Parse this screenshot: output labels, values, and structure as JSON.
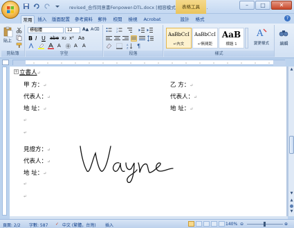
{
  "title_bar": {
    "title": "revised_合作同意書Fenpower-DTL.docx [相容模式] - Microsoft ...",
    "context_tab": "表格工具",
    "minimize": "–",
    "maximize": "□",
    "close": "✕"
  },
  "tabs": [
    {
      "label": "常用",
      "active": true
    },
    {
      "label": "插入",
      "active": false
    },
    {
      "label": "版面配置",
      "active": false
    },
    {
      "label": "參考資料",
      "active": false
    },
    {
      "label": "郵件",
      "active": false
    },
    {
      "label": "校閱",
      "active": false
    },
    {
      "label": "檢視",
      "active": false
    },
    {
      "label": "Acrobat",
      "active": false
    },
    {
      "label": "設計",
      "active": false
    },
    {
      "label": "格式",
      "active": false
    }
  ],
  "ribbon": {
    "clipboard": {
      "label": "剪貼簿",
      "paste_label": "貼上"
    },
    "font": {
      "label": "字型",
      "font_name": "標楷體",
      "font_size": "12"
    },
    "paragraph": {
      "label": "段落"
    },
    "styles": {
      "label": "樣式",
      "items": [
        {
          "sample": "AaBbCcI",
          "name": "↵內文",
          "selected": true
        },
        {
          "sample": "AaBbCcI",
          "name": "↵無間距",
          "selected": false
        },
        {
          "sample": "AaB",
          "name": "標題 1",
          "selected": false
        }
      ],
      "change_styles": "變更樣式"
    },
    "editing": {
      "label": "編輯"
    }
  },
  "document": {
    "heading": "立書人",
    "left_block": [
      "甲  方：",
      "代表人：",
      "地  址："
    ],
    "right_block": [
      "乙  方：",
      "代表人：",
      "地  址："
    ],
    "witness_block": [
      "見證方：",
      "代表人：",
      "地  址："
    ],
    "signature": "Wayne",
    "paragraph_mark": "↵"
  },
  "status_bar": {
    "page": "頁面: 2/2",
    "word_count": "字數: 587",
    "language": "中文 (繁體，台灣)",
    "mode": "插入",
    "zoom": "140%"
  }
}
